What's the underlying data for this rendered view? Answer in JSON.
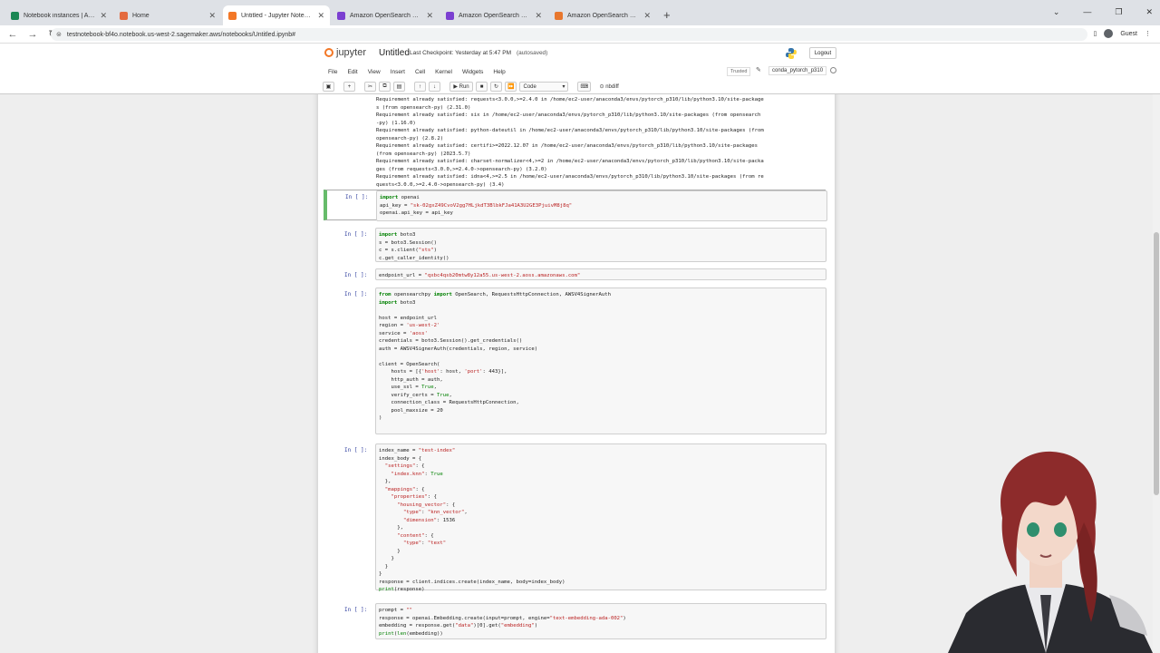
{
  "browser": {
    "tabs": [
      {
        "label": "Notebook instances | Amazon",
        "color": "#1a8754",
        "active": false
      },
      {
        "label": "Home",
        "color": "#e46b3f",
        "active": false
      },
      {
        "label": "Untitled - Jupyter Notebook",
        "color": "#f37726",
        "active": true
      },
      {
        "label": "Amazon OpenSearch Console",
        "color": "#7b3fd1",
        "active": false
      },
      {
        "label": "Amazon OpenSearch Console",
        "color": "#7b3fd1",
        "active": false
      },
      {
        "label": "Amazon OpenSearch Service",
        "color": "#e8772e",
        "active": false
      }
    ],
    "url": "testnotebook-bf4o.notebook.us-west-2.sagemaker.aws/notebooks/Untitled.ipynb#",
    "profile": "Guest"
  },
  "jupyter": {
    "logo_text": "jupyter",
    "notebook_title": "Untitled",
    "checkpoint": "Last Checkpoint: Yesterday at 5:47 PM",
    "autosave": "(autosaved)",
    "logout_label": "Logout",
    "menus": [
      "File",
      "Edit",
      "View",
      "Insert",
      "Cell",
      "Kernel",
      "Widgets",
      "Help"
    ],
    "trusted": "Trusted",
    "kernel": "conda_pytorch_p310",
    "run_label": "Run",
    "cell_type": "Code",
    "nbdiff": "nbdiff"
  },
  "output_lines": [
    "Requirement already satisfied: requests<3.0.0,>=2.4.0 in /home/ec2-user/anaconda3/envs/pytorch_p310/lib/python3.10/site-package",
    "s (from opensearch-py) (2.31.0)",
    "Requirement already satisfied: six in /home/ec2-user/anaconda3/envs/pytorch_p310/lib/python3.10/site-packages (from opensearch",
    "-py) (1.16.0)",
    "Requirement already satisfied: python-dateutil in /home/ec2-user/anaconda3/envs/pytorch_p310/lib/python3.10/site-packages (from",
    "opensearch-py) (2.8.2)",
    "Requirement already satisfied: certifi>=2022.12.07 in /home/ec2-user/anaconda3/envs/pytorch_p310/lib/python3.10/site-packages",
    "(from opensearch-py) (2023.5.7)",
    "Requirement already satisfied: charset-normalizer<4,>=2 in /home/ec2-user/anaconda3/envs/pytorch_p310/lib/python3.10/site-packa",
    "ges (from requests<3.0.0,>=2.4.0->opensearch-py) (3.2.0)",
    "Requirement already satisfied: idna<4,>=2.5 in /home/ec2-user/anaconda3/envs/pytorch_p310/lib/python3.10/site-packages (from re",
    "quests<3.0.0,>=2.4.0->opensearch-py) (3.4)"
  ],
  "cells": [
    {
      "prompt": "In [ ]:",
      "code": "import openai\napi_key = \"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\"\nopenai.api_key = api_key"
    },
    {
      "prompt": "In [ ]:",
      "code": "import boto3\ns = boto3.Session()\nc = s.client(\"sts\")\nc.get_caller_identity()"
    },
    {
      "prompt": "In [ ]:",
      "code": "endpoint_url = \"qxbc4qsb20mtw8y12a55.us-west-2.aoss.amazonaws.com\""
    },
    {
      "prompt": "In [ ]:",
      "code": "from opensearchpy import OpenSearch, RequestsHttpConnection, AWSV4SignerAuth\nimport boto3\n\nhost = endpoint_url\nregion = 'us-west-2'\nservice = 'aoss'\ncredentials = boto3.Session().get_credentials()\nauth = AWSV4SignerAuth(credentials, region, service)\n\nclient = OpenSearch(\n    hosts = [{'host': host, 'port': 443}],\n    http_auth = auth,\n    use_ssl = True,\n    verify_certs = True,\n    connection_class = RequestsHttpConnection,\n    pool_maxsize = 20\n)\n\n"
    },
    {
      "prompt": "In [ ]:",
      "code": "index_name = \"test-index\"\nindex_body = {\n  \"settings\": {\n    \"index.knn\": True\n  },\n  \"mappings\": {\n    \"properties\": {\n      \"housing_vector\": {\n        \"type\": \"knn_vector\",\n        \"dimension\": 1536\n      },\n      \"content\": {\n        \"type\": \"text\"\n      }\n    }\n  }\n}\nresponse = client.indices.create(index_name, body=index_body)\nprint(response)\n"
    },
    {
      "prompt": "In [ ]:",
      "code": "prompt = \"\"\nresponse = openai.Embedding.create(input=prompt, engine=\"text-embedding-ada-002\")\nembedding = response.get(\"data\")[0].get(\"embedding\")\nprint(len(embedding))"
    }
  ]
}
